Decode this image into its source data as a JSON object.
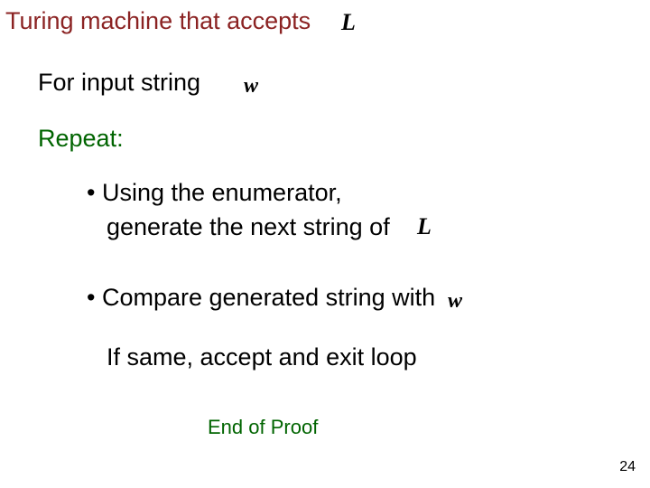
{
  "title": "Turing machine that accepts",
  "symbols": {
    "L": "L",
    "w": "w"
  },
  "for_input_string": "For input string",
  "repeat_label": "Repeat:",
  "bullets": {
    "b1_line1": "• Using the enumerator,",
    "b1_line2": "generate the next string of",
    "b2": "• Compare generated string with"
  },
  "if_same": "If same, accept and exit loop",
  "end_of_proof": "End of Proof",
  "page_number": "24"
}
